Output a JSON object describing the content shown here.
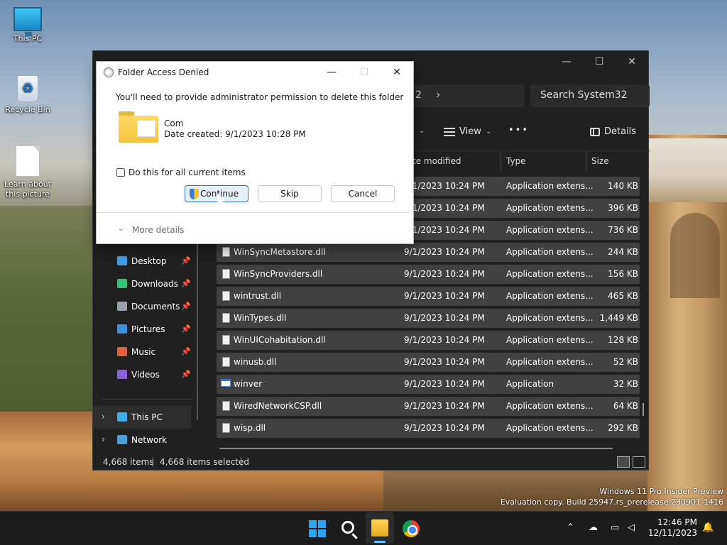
{
  "desktop": {
    "icons": [
      {
        "label": "This PC"
      },
      {
        "label": "Recycle Bin"
      },
      {
        "label": "Learn about this picture"
      }
    ],
    "watermark": {
      "line1": "Windows 11 Pro Insider Preview",
      "line2": "Evaluation copy. Build 25947.rs_prerelease.230901-1416"
    }
  },
  "explorer": {
    "address_tail": "2",
    "search_placeholder": "Search System32",
    "command_bar": {
      "view_label": "View",
      "more_label": "•••",
      "details_label": "Details"
    },
    "columns": [
      "te modified",
      "Type",
      "Size"
    ],
    "files": [
      {
        "name": "",
        "date": "9/1/2023 10:24 PM",
        "type": "Application extens...",
        "size": "140 KB",
        "icon": "dll-file-icon"
      },
      {
        "name": "",
        "date": "9/1/2023 10:24 PM",
        "type": "Application extens...",
        "size": "396 KB",
        "icon": "dll-file-icon"
      },
      {
        "name": "",
        "date": "9/1/2023 10:24 PM",
        "type": "Application extens...",
        "size": "736 KB",
        "icon": "dll-file-icon"
      },
      {
        "name": "WinSyncMetastore.dll",
        "date": "9/1/2023 10:24 PM",
        "type": "Application extens...",
        "size": "244 KB",
        "icon": "dll-file-icon"
      },
      {
        "name": "WinSyncProviders.dll",
        "date": "9/1/2023 10:24 PM",
        "type": "Application extens...",
        "size": "156 KB",
        "icon": "dll-file-icon"
      },
      {
        "name": "wintrust.dll",
        "date": "9/1/2023 10:24 PM",
        "type": "Application extens...",
        "size": "465 KB",
        "icon": "dll-file-icon"
      },
      {
        "name": "WinTypes.dll",
        "date": "9/1/2023 10:24 PM",
        "type": "Application extens...",
        "size": "1,449 KB",
        "icon": "dll-file-icon"
      },
      {
        "name": "WinUICohabitation.dll",
        "date": "9/1/2023 10:24 PM",
        "type": "Application extens...",
        "size": "128 KB",
        "icon": "dll-file-icon"
      },
      {
        "name": "winusb.dll",
        "date": "9/1/2023 10:24 PM",
        "type": "Application extens...",
        "size": "52 KB",
        "icon": "dll-file-icon"
      },
      {
        "name": "winver",
        "date": "9/1/2023 10:24 PM",
        "type": "Application",
        "size": "32 KB",
        "icon": "application-icon"
      },
      {
        "name": "WiredNetworkCSP.dll",
        "date": "9/1/2023 10:24 PM",
        "type": "Application extens...",
        "size": "64 KB",
        "icon": "dll-file-icon"
      },
      {
        "name": "wisp.dll",
        "date": "9/1/2023 10:24 PM",
        "type": "Application extens...",
        "size": "292 KB",
        "icon": "dll-file-icon"
      }
    ],
    "nav": {
      "quick_access": [
        {
          "label": "Desktop",
          "icon": "desktop-icon",
          "color": "#3aa0e8"
        },
        {
          "label": "Downloads",
          "icon": "download-icon",
          "color": "#34c27a"
        },
        {
          "label": "Documents",
          "icon": "documents-icon",
          "color": "#9aa3ad"
        },
        {
          "label": "Pictures",
          "icon": "pictures-icon",
          "color": "#3f8fe0"
        },
        {
          "label": "Music",
          "icon": "music-icon",
          "color": "#e0613f"
        },
        {
          "label": "Videos",
          "icon": "videos-icon",
          "color": "#8a5fe0"
        }
      ],
      "this_pc": "This PC",
      "network": "Network"
    },
    "status": {
      "items": "4,668 items",
      "selected": "4,668 items selected"
    }
  },
  "dialog": {
    "title": "Folder Access Denied",
    "message": "You'll need to provide administrator permission to delete this folder",
    "folder_name": "Com",
    "date_created": "Date created: 9/1/2023 10:28 PM",
    "checkbox_label": "Do this for all current items",
    "buttons": {
      "continue": "Continue",
      "skip": "Skip",
      "cancel": "Cancel"
    },
    "more_details": "More details"
  },
  "taskbar": {
    "time": "12:46 PM",
    "date": "12/11/2023"
  },
  "colors": {
    "accent": "#2f6ec9",
    "explorer_bg": "#202020",
    "selection_row": "#414141"
  }
}
